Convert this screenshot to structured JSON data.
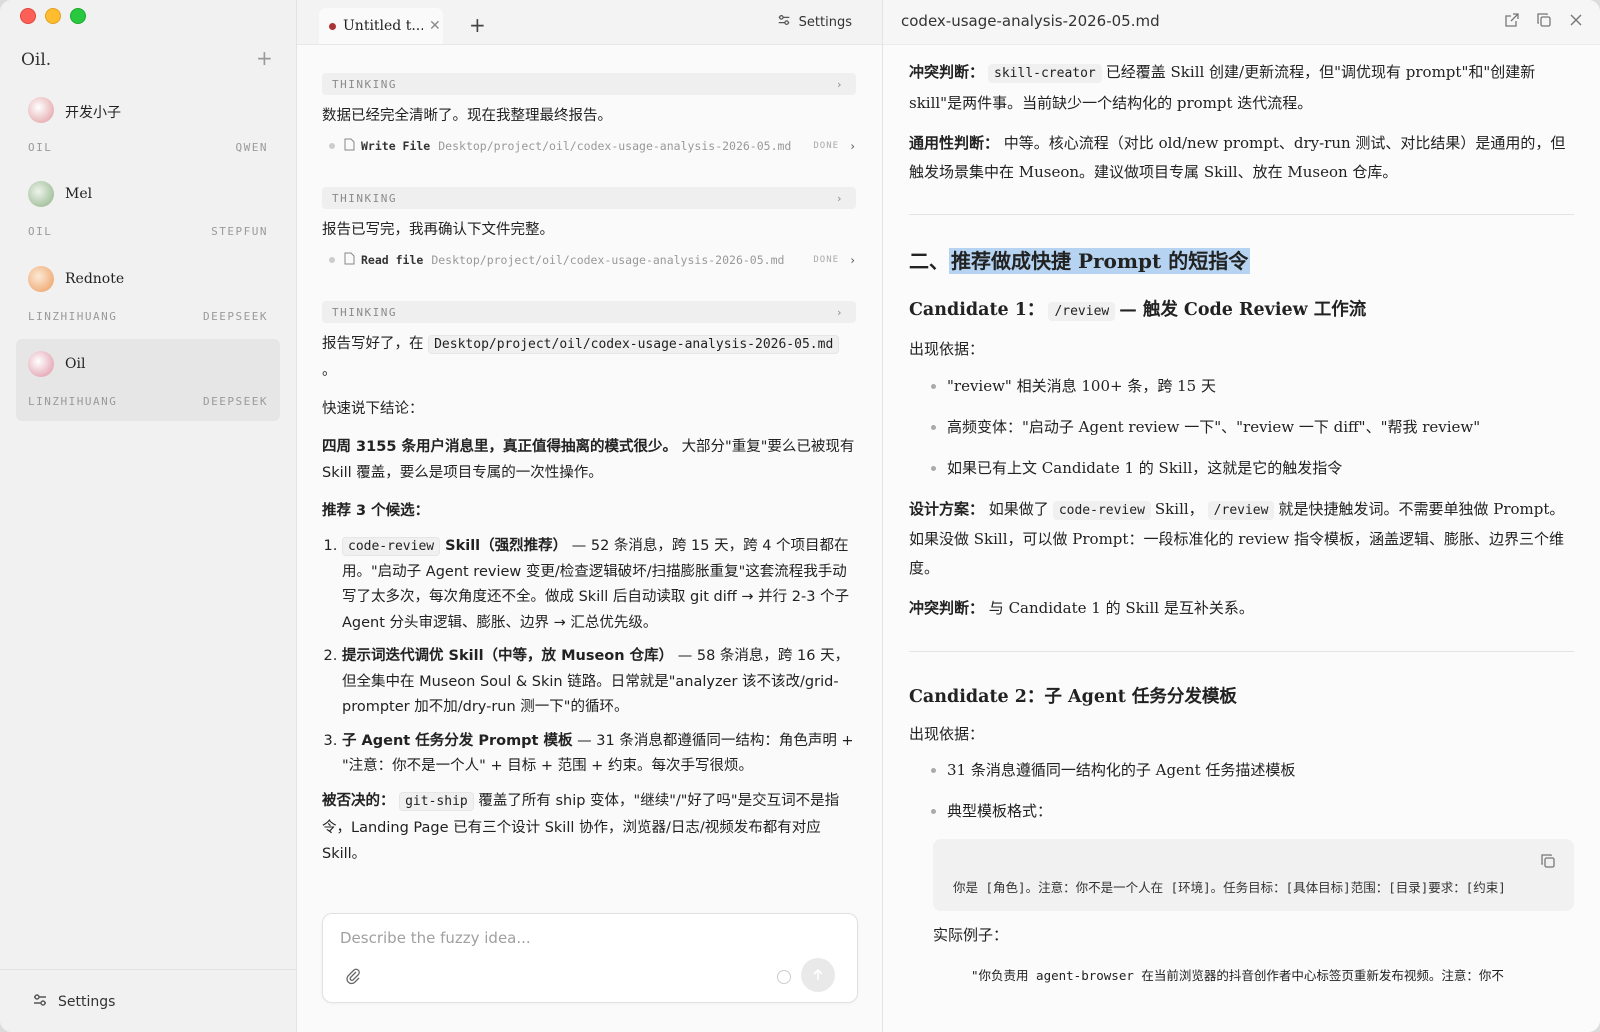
{
  "sidebar": {
    "brand": "Oil.",
    "add_label": "+",
    "sessions": [
      {
        "name": "开发小子",
        "meta_left": "OIL",
        "meta_right": "QWEN",
        "color": "#e8b5b8"
      },
      {
        "name": "Mel",
        "meta_left": "OIL",
        "meta_right": "STEPFUN",
        "color": "#a9c4a3"
      },
      {
        "name": "Rednote",
        "meta_left": "LINZHIHUANG",
        "meta_right": "DEEPSEEK",
        "color": "#f0b27f"
      },
      {
        "name": "Oil",
        "meta_left": "LINZHIHUANG",
        "meta_right": "DEEPSEEK",
        "color": "#e7b0bd"
      }
    ],
    "settings_label": "Settings"
  },
  "chat": {
    "tab_title": "Untitled t...",
    "tab_close": "✕",
    "tab_new": "+",
    "settings_label": "Settings",
    "thinking_label": "THINKING",
    "msg1": "数据已经完全清晰了。现在我整理最终报告。",
    "tool1": {
      "verb": "Write File",
      "path": "Desktop/project/oil/codex-usage-analysis-2026-05.md",
      "status": "DONE"
    },
    "msg2": "报告已写完，我再确认下文件完整。",
    "tool2": {
      "verb": "Read file",
      "path": "Desktop/project/oil/codex-usage-analysis-2026-05.md",
      "status": "DONE"
    },
    "msg3_pre": "报告写好了，在",
    "msg3_path": "Desktop/project/oil/codex-usage-analysis-2026-05.md",
    "msg3_post": "。",
    "msg4": "快速说下结论：",
    "msg5_bold": "四周 3155 条用户消息里，真正值得抽离的模式很少。",
    "msg5_rest": "大部分\"重复\"要么已被现有 Skill 覆盖，要么是项目专属的一次性操作。",
    "msg6": "推荐 3 个候选：",
    "items": [
      {
        "code": "code-review",
        "bold": " Skill（强烈推荐）",
        "text": " — 52 条消息，跨 15 天，跨 4 个项目都在用。\"启动子 Agent review 变更/检查逻辑破坏/扫描膨胀重复\"这套流程我手动写了太多次，每次角度还不全。做成 Skill 后自动读取 git diff → 并行 2-3 个子 Agent 分头审逻辑、膨胀、边界 → 汇总优先级。"
      },
      {
        "code": "",
        "bold": "提示词迭代调优 Skill（中等，放 Museon 仓库）",
        "text": " — 58 条消息，跨 16 天，但全集中在 Museon Soul & Skin 链路。日常就是\"analyzer 该不该改/grid-prompter 加不加/dry-run 测一下\"的循环。"
      },
      {
        "code": "",
        "bold": "子 Agent 任务分发 Prompt 模板",
        "text": " — 31 条消息都遵循同一结构：角色声明 + \"注意：你不是一个人\" + 目标 + 范围 + 约束。每次手写很烦。"
      }
    ],
    "rejected_label": "被否决的：",
    "rejected_code": "git-ship",
    "rejected_text": "覆盖了所有 ship 变体，\"继续\"/\"好了吗\"是交互词不是指令，Landing Page 已有三个设计 Skill 协作，浏览器/日志/视频发布都有对应 Skill。",
    "composer_placeholder": "Describe the fuzzy idea..."
  },
  "doc": {
    "filename": "codex-usage-analysis-2026-05.md",
    "conflict_label": "冲突判断：",
    "conflict_code": "skill-creator",
    "conflict_text": "已经覆盖 Skill 创建/更新流程，但\"调优现有 prompt\"和\"创建新 skill\"是两件事。当前缺少一个结构化的 prompt 迭代流程。",
    "general_label": "通用性判断：",
    "general_text": "中等。核心流程（对比 old/new prompt、dry-run 测试、对比结果）是通用的，但触发场景集中在 Museon。建议做项目专属 Skill、放在 Museon 仓库。",
    "section2_prefix": "二、",
    "section2_title": "推荐做成快捷 Prompt 的短指令",
    "c1_title_pre": "Candidate 1：",
    "c1_code": "/review",
    "c1_title_post": "— 触发 Code Review 工作流",
    "evidence_label": "出现依据：",
    "c1_bullets": [
      "\"review\" 相关消息 100+ 条，跨 15 天",
      "高频变体：\"启动子 Agent review 一下\"、\"review 一下 diff\"、\"帮我 review\"",
      "如果已有上文 Candidate 1 的 Skill，这就是它的触发指令"
    ],
    "design_label": "设计方案：",
    "design_pre": "如果做了",
    "design_code1": "code-review",
    "design_mid": "Skill，",
    "design_code2": "/review",
    "design_post": "就是快捷触发词。不需要单独做 Prompt。如果没做 Skill，可以做 Prompt：一段标准化的 review 指令模板，涵盖逻辑、膨胀、边界三个维度。",
    "c1_conflict_label": "冲突判断：",
    "c1_conflict_text": "与 Candidate 1 的 Skill 是互补关系。",
    "c2_title": "Candidate 2：子 Agent 任务分发模板",
    "c2_bullets": [
      "31 条消息遵循同一结构化的子 Agent 任务描述模板",
      "典型模板格式："
    ],
    "template_code": "你是 [角色]。注意：你不是一个人在 [环境]。任务目标：[具体目标]范围：[目录]要求：[约束]",
    "example_label": "实际例子：",
    "example_text": "\"你负责用 agent-browser 在当前浏览器的抖音创作者中心标签页重新发布视频。注意：你不"
  }
}
